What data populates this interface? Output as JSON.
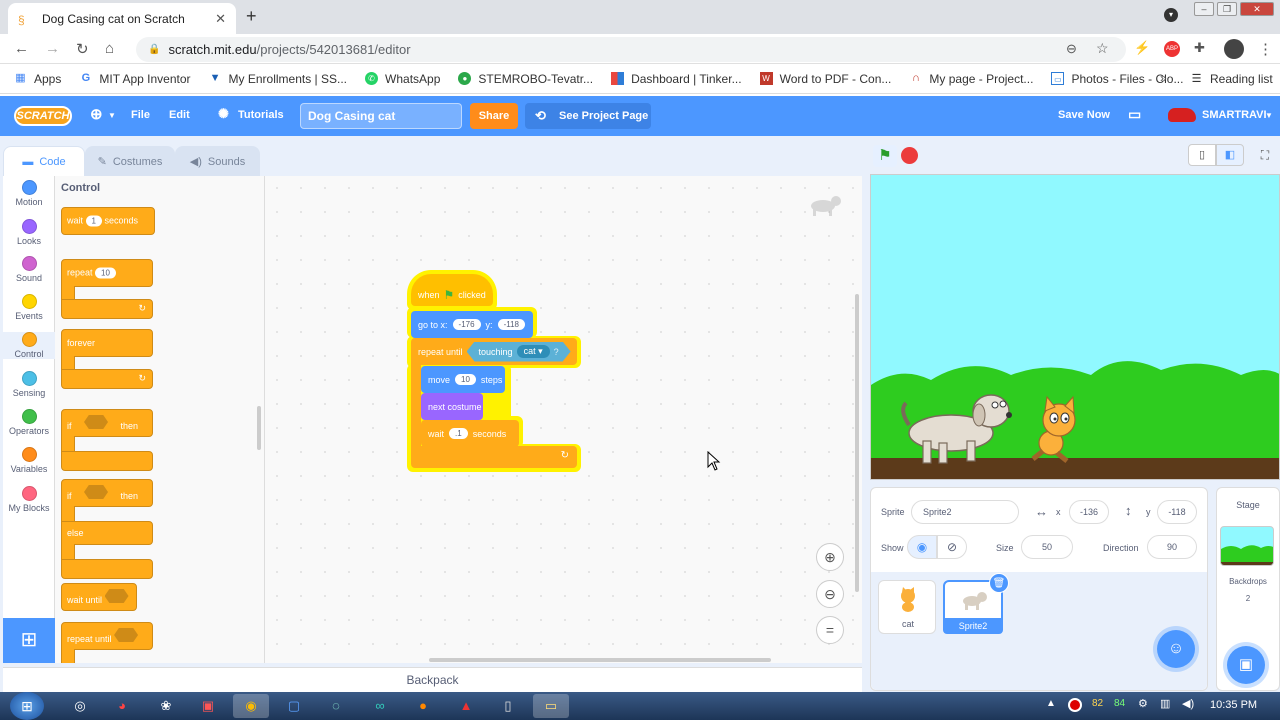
{
  "browser": {
    "tab_title": "Dog Casing cat on Scratch",
    "url_host": "scratch.mit.edu",
    "url_path": "/projects/542013681/editor",
    "bookmarks": [
      "Apps",
      "MIT App Inventor",
      "My Enrollments | SS...",
      "WhatsApp",
      "STEMROBO-Tevatr...",
      "Dashboard | Tinker...",
      "Word to PDF - Con...",
      "My page - Project...",
      "Photos - Files - Clo..."
    ],
    "reading_list": "Reading list"
  },
  "menu": {
    "logo": "SCRATCH",
    "file": "File",
    "edit": "Edit",
    "tutorials": "Tutorials",
    "project_title": "Dog Casing cat",
    "share": "Share",
    "see_project": "See Project Page",
    "save_now": "Save Now",
    "username": "SMARTRAVI"
  },
  "tabs": {
    "code": "Code",
    "costumes": "Costumes",
    "sounds": "Sounds"
  },
  "categories": [
    {
      "label": "Motion",
      "color": "#4c97ff"
    },
    {
      "label": "Looks",
      "color": "#9966ff"
    },
    {
      "label": "Sound",
      "color": "#cf63cf"
    },
    {
      "label": "Events",
      "color": "#ffd500"
    },
    {
      "label": "Control",
      "color": "#ffab19"
    },
    {
      "label": "Sensing",
      "color": "#4cbfe6"
    },
    {
      "label": "Operators",
      "color": "#40bf4a"
    },
    {
      "label": "Variables",
      "color": "#ff8c1a"
    },
    {
      "label": "My Blocks",
      "color": "#ff6680"
    }
  ],
  "palette": {
    "heading": "Control",
    "wait": "wait",
    "wait_val": "1",
    "seconds": "seconds",
    "repeat": "repeat",
    "repeat_val": "10",
    "forever": "forever",
    "if": "if",
    "then": "then",
    "else": "else",
    "wait_until": "wait until",
    "repeat_until": "repeat until"
  },
  "script": {
    "when": "when",
    "clicked": "clicked",
    "goto": "go to x:",
    "x_val": "-176",
    "y_label": "y:",
    "y_val": "-118",
    "repeat_until": "repeat until",
    "touching": "touching",
    "touch_target": "cat",
    "q": "?",
    "move": "move",
    "move_val": "10",
    "steps": "steps",
    "next_costume": "next costume",
    "wait": "wait",
    "wait_val": ".1",
    "seconds": "seconds"
  },
  "backpack": "Backpack",
  "sprite_info": {
    "sprite_label": "Sprite",
    "sprite_name": "Sprite2",
    "x_label": "x",
    "x_val": "-136",
    "y_label": "y",
    "y_val": "-118",
    "show_label": "Show",
    "size_label": "Size",
    "size_val": "50",
    "direction_label": "Direction",
    "direction_val": "90"
  },
  "sprites": [
    {
      "name": "cat",
      "selected": false
    },
    {
      "name": "Sprite2",
      "selected": true
    }
  ],
  "stage_pane": {
    "title": "Stage",
    "backdrops_label": "Backdrops",
    "backdrops_count": "2"
  },
  "taskbar": {
    "time": "10:35 PM",
    "tray_a": "82",
    "tray_b": "84"
  },
  "colors": {
    "scratch_blue": "#4c97ff",
    "control": "#ffab19",
    "motion": "#4c97ff",
    "looks": "#9966ff",
    "sensing": "#5cb1d6"
  }
}
